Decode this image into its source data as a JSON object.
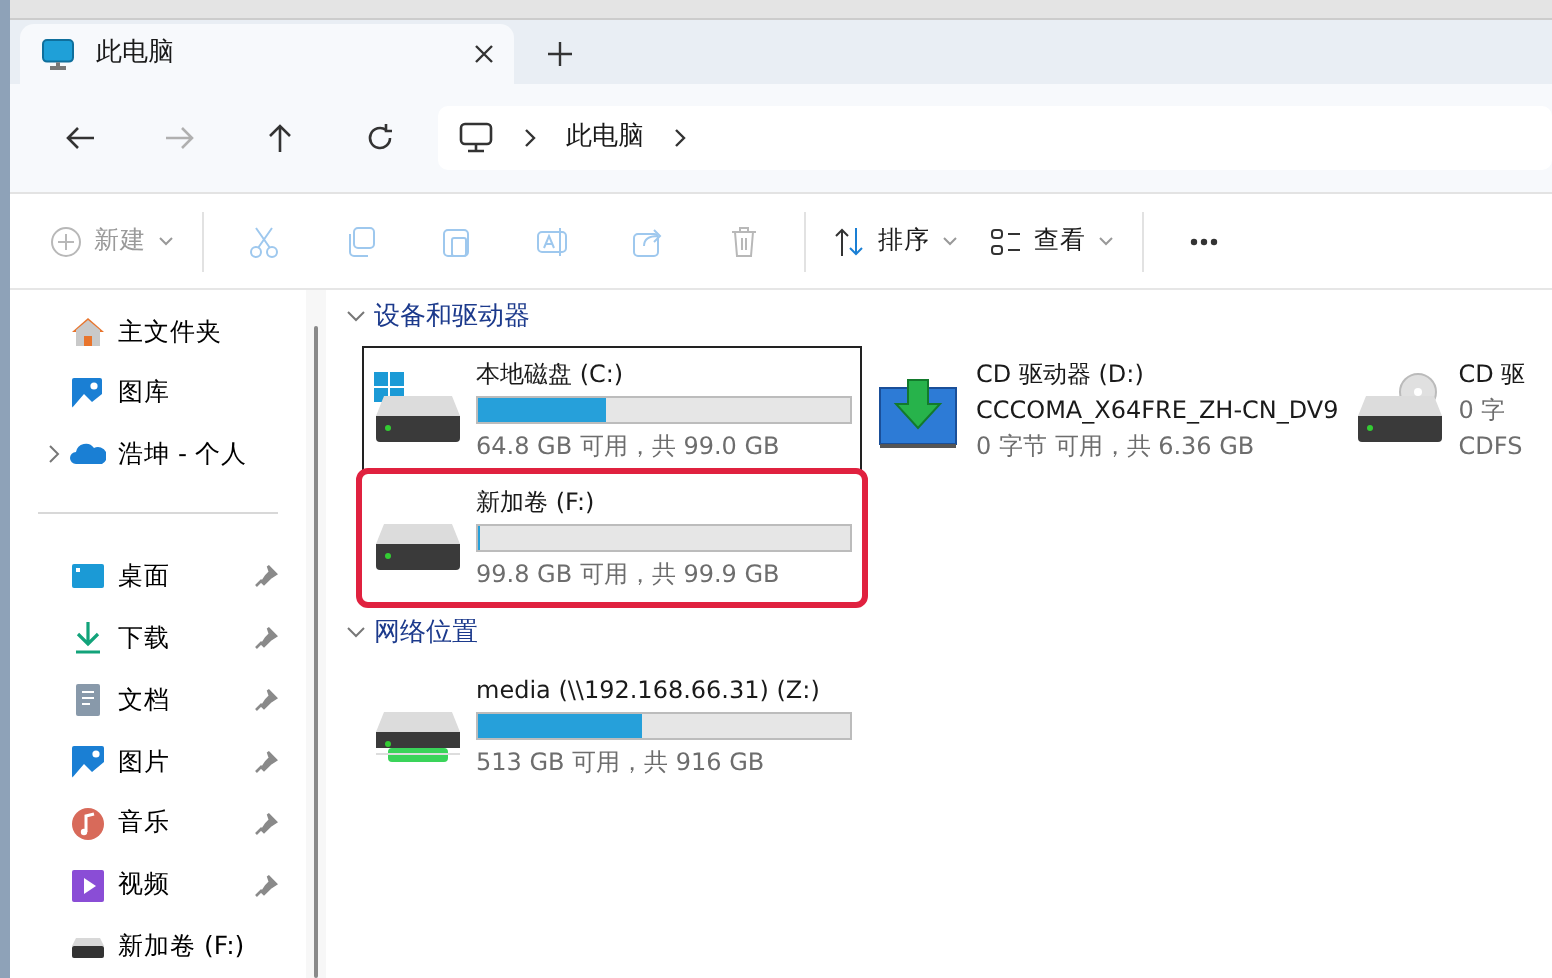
{
  "tab": {
    "title": "此电脑",
    "selected": true
  },
  "nav": {
    "back_disabled": false,
    "forward_disabled": true
  },
  "breadcrumb": [
    "此电脑"
  ],
  "toolbar": [
    {
      "kind": "new",
      "label": "新建",
      "disabled": true,
      "caret": true
    },
    {
      "kind": "cut",
      "disabled": true
    },
    {
      "kind": "copy",
      "disabled": true
    },
    {
      "kind": "paste",
      "disabled": true
    },
    {
      "kind": "rename",
      "disabled": true
    },
    {
      "kind": "share",
      "disabled": true
    },
    {
      "kind": "delete",
      "disabled": true
    },
    {
      "kind": "sort",
      "label": "排序",
      "disabled": false,
      "caret": true
    },
    {
      "kind": "view",
      "label": "查看",
      "disabled": false,
      "caret": true
    },
    {
      "kind": "more",
      "disabled": false
    }
  ],
  "sidebar": {
    "top": [
      {
        "kind": "home",
        "label": "主文件夹",
        "expandable": false
      },
      {
        "kind": "gallery",
        "label": "图库",
        "expandable": false
      },
      {
        "kind": "cloud",
        "label": "浩坤 - 个人",
        "expandable": true
      }
    ],
    "quick": [
      {
        "kind": "desktop",
        "label": "桌面",
        "pinned": true
      },
      {
        "kind": "download",
        "label": "下载",
        "pinned": true
      },
      {
        "kind": "document",
        "label": "文档",
        "pinned": true
      },
      {
        "kind": "picture",
        "label": "图片",
        "pinned": true
      },
      {
        "kind": "music",
        "label": "音乐",
        "pinned": true
      },
      {
        "kind": "video",
        "label": "视频",
        "pinned": true
      },
      {
        "kind": "drive",
        "label": "新加卷 (F:)",
        "pinned": false
      }
    ]
  },
  "sections": [
    {
      "title": "设备和驱动器",
      "expanded": true,
      "items": [
        {
          "kind": "windows",
          "name": "本地磁盘 (C:)",
          "level": 0.345,
          "info": "64.8 GB 可用，共 99.0 GB",
          "selected": true,
          "highlighted": false
        },
        {
          "kind": "cd-install",
          "name": "CD 驱动器 (D:)",
          "label": "CCCOMA_X64FRE_ZH-CN_DV9",
          "info": "0 字节 可用，共 6.36 GB",
          "selected": false,
          "highlighted": false
        },
        {
          "kind": "cd",
          "name": "CD 驱",
          "info": "0 字",
          "filesystem": "CDFS",
          "selected": false,
          "highlighted": false
        },
        {
          "kind": "hdd",
          "name": "新加卷 (F:)",
          "level": 0.001,
          "info": "99.8 GB 可用，共 99.9 GB",
          "selected": false,
          "highlighted": true
        }
      ]
    },
    {
      "title": "网络位置",
      "expanded": true,
      "items": [
        {
          "kind": "network",
          "name": "media (\\\\192.168.66.31) (Z:)",
          "level": 0.44,
          "info": "513 GB 可用，共 916 GB",
          "selected": false,
          "highlighted": false
        }
      ]
    }
  ]
}
